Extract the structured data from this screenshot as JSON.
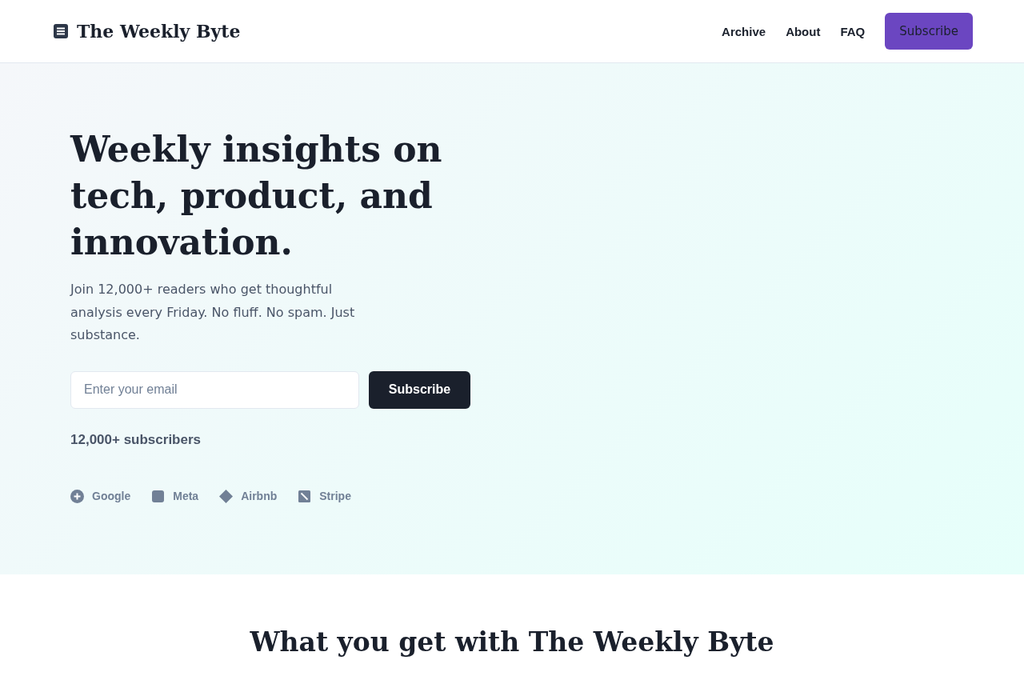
{
  "header": {
    "logo": {
      "title": "The Weekly Byte"
    },
    "nav": [
      {
        "label": "Archive",
        "kind": "link"
      },
      {
        "label": "About",
        "kind": "link"
      },
      {
        "label": "FAQ",
        "kind": "link"
      },
      {
        "label": "Subscribe",
        "kind": "button"
      }
    ]
  },
  "hero": {
    "heading": "Weekly insights on tech, product, and innovation.",
    "description": "Join 12,000+ readers who get thoughtful analysis every Friday. No fluff. No spam. Just substance.",
    "email_field": {
      "placeholder": "Enter your email"
    },
    "submit_button": "Subscribe",
    "subscriber_count": "12,000+ subscribers",
    "companies": [
      {
        "name": "Google",
        "kind": "circle"
      },
      {
        "name": "Meta",
        "kind": "square"
      },
      {
        "name": "Airbnb",
        "kind": "diamond"
      },
      {
        "name": "Stripe",
        "kind": "slash"
      }
    ]
  },
  "features": {
    "heading": "What you get with The Weekly Byte"
  }
}
